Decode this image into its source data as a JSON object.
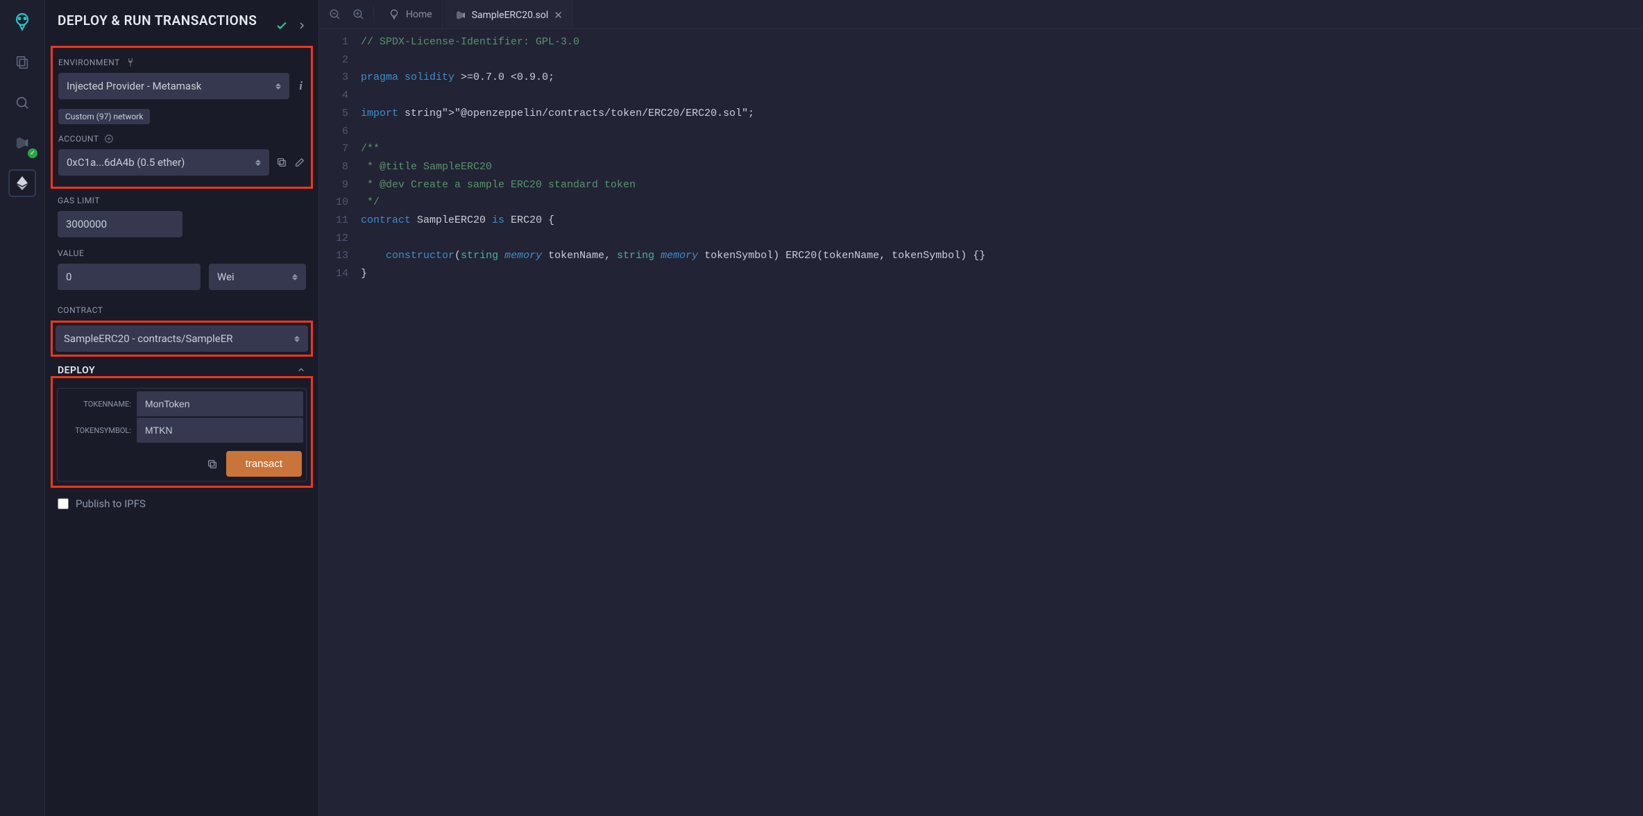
{
  "panel": {
    "title": "DEPLOY & RUN TRANSACTIONS",
    "environment_label": "ENVIRONMENT",
    "environment_value": "Injected Provider - Metamask",
    "network_badge": "Custom (97) network",
    "account_label": "ACCOUNT",
    "account_value": "0xC1a...6dA4b (0.5 ether)",
    "gas_label": "GAS LIMIT",
    "gas_value": "3000000",
    "value_label": "VALUE",
    "value_amount": "0",
    "value_unit": "Wei",
    "contract_label": "CONTRACT",
    "contract_value": "SampleERC20 - contracts/SampleER",
    "deploy_label": "DEPLOY",
    "param_tokenname_label": "TOKENNAME:",
    "param_tokenname_value": "MonToken",
    "param_tokensymbol_label": "TOKENSYMBOL:",
    "param_tokensymbol_value": "MTKN",
    "transact_label": "transact",
    "publish_label": "Publish to IPFS"
  },
  "tabs": {
    "home": "Home",
    "file": "SampleERC20.sol"
  },
  "code": {
    "lines": [
      "// SPDX-License-Identifier: GPL-3.0",
      "",
      "pragma solidity >=0.7.0 <0.9.0;",
      "",
      "import \"@openzeppelin/contracts/token/ERC20/ERC20.sol\";",
      "",
      "/**",
      " * @title SampleERC20",
      " * @dev Create a sample ERC20 standard token",
      " */",
      "contract SampleERC20 is ERC20 {",
      "",
      "    constructor(string memory tokenName, string memory tokenSymbol) ERC20(tokenName, tokenSymbol) {}",
      "}"
    ]
  }
}
